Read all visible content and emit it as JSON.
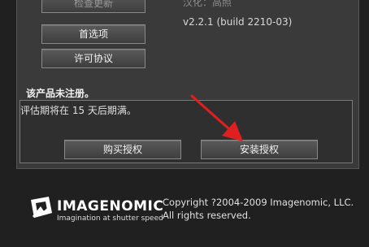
{
  "buttons": {
    "check_updates": "检查更新",
    "preferences": "首选项",
    "license_agreement": "许可协议",
    "buy_license": "购买授权",
    "install_license": "安装授权"
  },
  "header": {
    "localization": "汉化：高照",
    "version": "v2.2.1 (build 2210-03)"
  },
  "registration": {
    "status": "该产品未注册。",
    "evaluation": "评估期将在 15 天后期满。"
  },
  "brand": {
    "name": "IMAGENOMIC",
    "tagline": "Imagination at shutter speed"
  },
  "footer": {
    "copyright": "Copyright ?2004-2009 Imagenomic, LLC.",
    "rights": "All rights reserved."
  },
  "colors": {
    "arrow": "#e02020",
    "background": "#202020",
    "dialog": "#3a3a3a"
  }
}
